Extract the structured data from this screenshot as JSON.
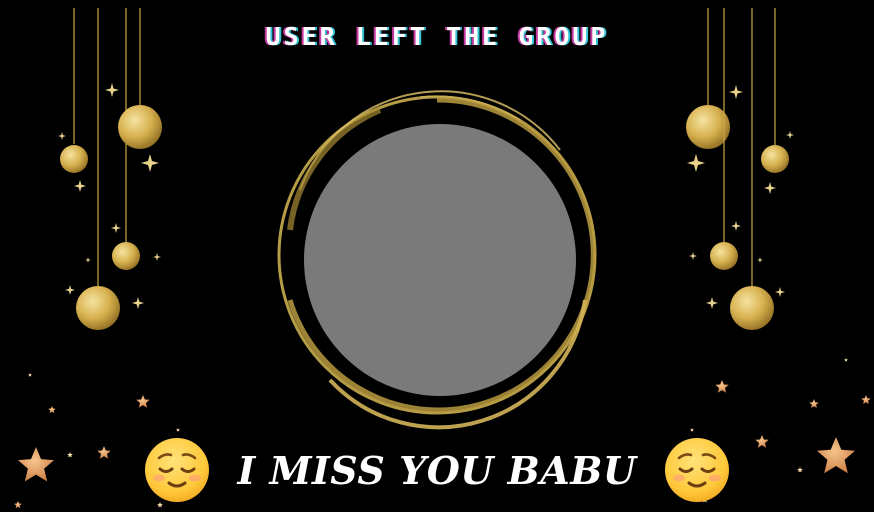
{
  "header": {
    "title": "USER LEFT THE GROUP"
  },
  "avatar": {
    "placeholder_color": "#7a7a7a",
    "frame_color": "#c9ae4c"
  },
  "footer": {
    "message": "I MISS YOU BABU",
    "emoji_left": "relieved-face-icon",
    "emoji_right": "relieved-face-icon"
  },
  "colors": {
    "background": "#000000",
    "gold": "#d9b54e",
    "star": "#e7a05f"
  }
}
